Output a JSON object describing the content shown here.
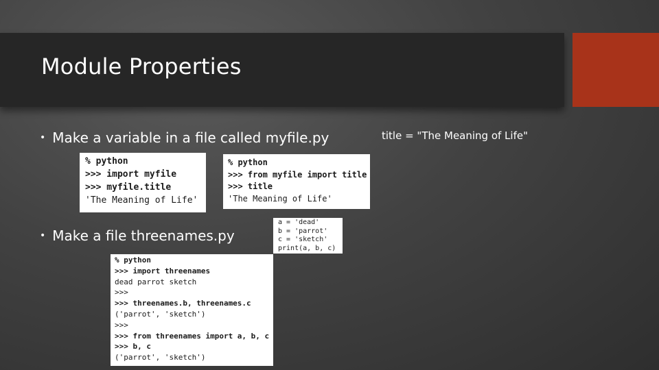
{
  "slide": {
    "title": "Module Properties",
    "bullets": [
      "Make a variable in a file called myfile.py",
      "Make a file threenames.py"
    ],
    "side_note": "title = \"The Meaning of Life\""
  },
  "colors": {
    "title_bar": "#262626",
    "accent": "#a8331a",
    "background": "#3e3e3e"
  },
  "code_blocks": {
    "myfile_session": [
      {
        "text": "% python",
        "bold": true
      },
      {
        "text": ">>> import myfile",
        "bold": true
      },
      {
        "text": ">>> myfile.title",
        "bold": true
      },
      {
        "text": "'The Meaning of Life'",
        "bold": false
      }
    ],
    "from_import_session": [
      {
        "text": "% python",
        "bold": true
      },
      {
        "text": ">>> from myfile import title",
        "bold": true
      },
      {
        "text": ">>> title",
        "bold": true
      },
      {
        "text": "'The Meaning of Life'",
        "bold": false
      }
    ],
    "threenames_file": [
      {
        "text": "a = 'dead'",
        "bold": false
      },
      {
        "text": "b = 'parrot'",
        "bold": false
      },
      {
        "text": "c = 'sketch'",
        "bold": false
      },
      {
        "text": "print(a, b, c)",
        "bold": false
      }
    ],
    "threenames_session": [
      {
        "text": "% python",
        "bold": true
      },
      {
        "text": ">>> import threenames",
        "bold": true
      },
      {
        "text": "dead parrot sketch",
        "bold": false
      },
      {
        "text": ">>>",
        "bold": false
      },
      {
        "text": ">>> threenames.b, threenames.c",
        "bold": true
      },
      {
        "text": "('parrot', 'sketch')",
        "bold": false
      },
      {
        "text": ">>>",
        "bold": false
      },
      {
        "text": ">>> from threenames import a, b, c",
        "bold": true
      },
      {
        "text": ">>> b, c",
        "bold": true
      },
      {
        "text": "('parrot', 'sketch')",
        "bold": false
      }
    ]
  }
}
